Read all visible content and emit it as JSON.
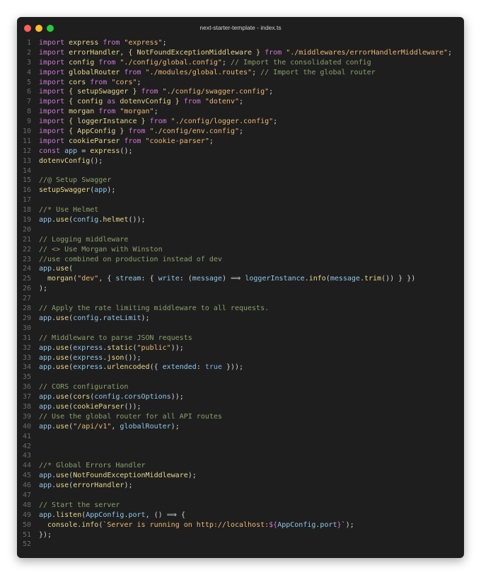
{
  "window": {
    "title": "next-starter-template - index.ts",
    "traffic_lights": [
      {
        "name": "close",
        "color": "#ff5f57"
      },
      {
        "name": "minimize",
        "color": "#febc2e"
      },
      {
        "name": "maximize",
        "color": "#28c840"
      }
    ]
  },
  "editor": {
    "lines": [
      {
        "n": "1",
        "tokens": [
          {
            "t": "import",
            "k": "keyword"
          },
          {
            "t": " express ",
            "k": "ident"
          },
          {
            "t": "from",
            "k": "keyword"
          },
          {
            "t": " \"express\"",
            "k": "string"
          },
          {
            "t": ";",
            "k": "punct"
          }
        ]
      },
      {
        "n": "2",
        "tokens": [
          {
            "t": "import",
            "k": "keyword"
          },
          {
            "t": " errorHandler, { NotFoundExceptionMiddleware } ",
            "k": "ident"
          },
          {
            "t": "from",
            "k": "keyword"
          },
          {
            "t": " \"./middlewares/errorHandlerMiddleware\"",
            "k": "string"
          },
          {
            "t": ";",
            "k": "punct"
          }
        ]
      },
      {
        "n": "3",
        "tokens": [
          {
            "t": "import",
            "k": "keyword"
          },
          {
            "t": " config ",
            "k": "ident"
          },
          {
            "t": "from",
            "k": "keyword"
          },
          {
            "t": " \"./config/global.config\"",
            "k": "string"
          },
          {
            "t": "; ",
            "k": "punct"
          },
          {
            "t": "// Import the consolidated config",
            "k": "comment"
          }
        ]
      },
      {
        "n": "4",
        "tokens": [
          {
            "t": "import",
            "k": "keyword"
          },
          {
            "t": " globalRouter ",
            "k": "ident"
          },
          {
            "t": "from",
            "k": "keyword"
          },
          {
            "t": " \"./modules/global.routes\"",
            "k": "string"
          },
          {
            "t": "; ",
            "k": "punct"
          },
          {
            "t": "// Import the global router",
            "k": "comment"
          }
        ]
      },
      {
        "n": "5",
        "tokens": [
          {
            "t": "import",
            "k": "keyword"
          },
          {
            "t": " cors ",
            "k": "ident"
          },
          {
            "t": "from",
            "k": "keyword"
          },
          {
            "t": " \"cors\"",
            "k": "string"
          },
          {
            "t": ";",
            "k": "punct"
          }
        ]
      },
      {
        "n": "6",
        "tokens": [
          {
            "t": "import",
            "k": "keyword"
          },
          {
            "t": " { setupSwagger } ",
            "k": "ident"
          },
          {
            "t": "from",
            "k": "keyword"
          },
          {
            "t": " \"./config/swagger.config\"",
            "k": "string"
          },
          {
            "t": ";",
            "k": "punct"
          }
        ]
      },
      {
        "n": "7",
        "tokens": [
          {
            "t": "import",
            "k": "keyword"
          },
          {
            "t": " { config ",
            "k": "ident"
          },
          {
            "t": "as",
            "k": "keyword"
          },
          {
            "t": " dotenvConfig } ",
            "k": "ident"
          },
          {
            "t": "from",
            "k": "keyword"
          },
          {
            "t": " \"dotenv\"",
            "k": "string"
          },
          {
            "t": ";",
            "k": "punct"
          }
        ]
      },
      {
        "n": "8",
        "tokens": [
          {
            "t": "import",
            "k": "keyword"
          },
          {
            "t": " morgan ",
            "k": "ident"
          },
          {
            "t": "from",
            "k": "keyword"
          },
          {
            "t": " \"morgan\"",
            "k": "string"
          },
          {
            "t": ";",
            "k": "punct"
          }
        ]
      },
      {
        "n": "9",
        "tokens": [
          {
            "t": "import",
            "k": "keyword"
          },
          {
            "t": " { loggerInstance } ",
            "k": "ident"
          },
          {
            "t": "from",
            "k": "keyword"
          },
          {
            "t": " \"./config/logger.config\"",
            "k": "string"
          },
          {
            "t": ";",
            "k": "punct"
          }
        ]
      },
      {
        "n": "10",
        "tokens": [
          {
            "t": "import",
            "k": "keyword"
          },
          {
            "t": " { AppConfig } ",
            "k": "ident"
          },
          {
            "t": "from",
            "k": "keyword"
          },
          {
            "t": " \"./config/env.config\"",
            "k": "string"
          },
          {
            "t": ";",
            "k": "punct"
          }
        ]
      },
      {
        "n": "11",
        "tokens": [
          {
            "t": "import",
            "k": "keyword"
          },
          {
            "t": " cookieParser ",
            "k": "ident"
          },
          {
            "t": "from",
            "k": "keyword"
          },
          {
            "t": " \"cookie-parser\"",
            "k": "string"
          },
          {
            "t": ";",
            "k": "punct"
          }
        ]
      },
      {
        "n": "12",
        "tokens": [
          {
            "t": "const",
            "k": "keyword"
          },
          {
            "t": " app ",
            "k": "var"
          },
          {
            "t": "= ",
            "k": "punct"
          },
          {
            "t": "express",
            "k": "func"
          },
          {
            "t": "();",
            "k": "punct"
          }
        ]
      },
      {
        "n": "13",
        "tokens": [
          {
            "t": "dotenvConfig",
            "k": "func"
          },
          {
            "t": "();",
            "k": "punct"
          }
        ]
      },
      {
        "n": "14",
        "tokens": []
      },
      {
        "n": "15",
        "tokens": [
          {
            "t": "//@ Setup Swagger",
            "k": "comment"
          }
        ]
      },
      {
        "n": "16",
        "tokens": [
          {
            "t": "setupSwagger",
            "k": "func"
          },
          {
            "t": "(",
            "k": "punct"
          },
          {
            "t": "app",
            "k": "var"
          },
          {
            "t": ");",
            "k": "punct"
          }
        ]
      },
      {
        "n": "17",
        "tokens": []
      },
      {
        "n": "18",
        "tokens": [
          {
            "t": "//* Use Helmet",
            "k": "comment"
          }
        ]
      },
      {
        "n": "19",
        "tokens": [
          {
            "t": "app",
            "k": "var"
          },
          {
            "t": ".",
            "k": "punct"
          },
          {
            "t": "use",
            "k": "func"
          },
          {
            "t": "(",
            "k": "punct"
          },
          {
            "t": "config",
            "k": "var"
          },
          {
            "t": ".",
            "k": "punct"
          },
          {
            "t": "helmet",
            "k": "func"
          },
          {
            "t": "());",
            "k": "punct"
          }
        ]
      },
      {
        "n": "20",
        "tokens": []
      },
      {
        "n": "21",
        "tokens": [
          {
            "t": "// Logging middleware",
            "k": "comment"
          }
        ]
      },
      {
        "n": "22",
        "tokens": [
          {
            "t": "// <> Use Morgan with Winston",
            "k": "comment"
          }
        ]
      },
      {
        "n": "23",
        "tokens": [
          {
            "t": "//use combined on production instead of dev",
            "k": "comment"
          }
        ]
      },
      {
        "n": "24",
        "tokens": [
          {
            "t": "app",
            "k": "var"
          },
          {
            "t": ".",
            "k": "punct"
          },
          {
            "t": "use",
            "k": "func"
          },
          {
            "t": "(",
            "k": "punct"
          }
        ]
      },
      {
        "n": "25",
        "tokens": [
          {
            "t": "  morgan",
            "k": "func"
          },
          {
            "t": "(",
            "k": "punct"
          },
          {
            "t": "\"dev\"",
            "k": "string"
          },
          {
            "t": ", { ",
            "k": "punct"
          },
          {
            "t": "stream",
            "k": "prop"
          },
          {
            "t": ": { ",
            "k": "punct"
          },
          {
            "t": "write",
            "k": "prop"
          },
          {
            "t": ": (",
            "k": "punct"
          },
          {
            "t": "message",
            "k": "var"
          },
          {
            "t": ") ⟹ ",
            "k": "punct"
          },
          {
            "t": "loggerInstance",
            "k": "var"
          },
          {
            "t": ".",
            "k": "punct"
          },
          {
            "t": "info",
            "k": "func"
          },
          {
            "t": "(",
            "k": "punct"
          },
          {
            "t": "message",
            "k": "var"
          },
          {
            "t": ".",
            "k": "punct"
          },
          {
            "t": "trim",
            "k": "func"
          },
          {
            "t": "()) } })",
            "k": "punct"
          }
        ]
      },
      {
        "n": "26",
        "tokens": [
          {
            "t": ");",
            "k": "punct"
          }
        ]
      },
      {
        "n": "27",
        "tokens": []
      },
      {
        "n": "28",
        "tokens": [
          {
            "t": "// Apply the rate limiting middleware to all requests.",
            "k": "comment"
          }
        ]
      },
      {
        "n": "29",
        "tokens": [
          {
            "t": "app",
            "k": "var"
          },
          {
            "t": ".",
            "k": "punct"
          },
          {
            "t": "use",
            "k": "func"
          },
          {
            "t": "(",
            "k": "punct"
          },
          {
            "t": "config",
            "k": "var"
          },
          {
            "t": ".",
            "k": "punct"
          },
          {
            "t": "rateLimit",
            "k": "prop"
          },
          {
            "t": ");",
            "k": "punct"
          }
        ]
      },
      {
        "n": "30",
        "tokens": []
      },
      {
        "n": "31",
        "tokens": [
          {
            "t": "// Middleware to parse JSON requests",
            "k": "comment"
          }
        ]
      },
      {
        "n": "32",
        "tokens": [
          {
            "t": "app",
            "k": "var"
          },
          {
            "t": ".",
            "k": "punct"
          },
          {
            "t": "use",
            "k": "func"
          },
          {
            "t": "(",
            "k": "punct"
          },
          {
            "t": "express",
            "k": "var"
          },
          {
            "t": ".",
            "k": "punct"
          },
          {
            "t": "static",
            "k": "func"
          },
          {
            "t": "(",
            "k": "punct"
          },
          {
            "t": "\"public\"",
            "k": "string"
          },
          {
            "t": "));",
            "k": "punct"
          }
        ]
      },
      {
        "n": "33",
        "tokens": [
          {
            "t": "app",
            "k": "var"
          },
          {
            "t": ".",
            "k": "punct"
          },
          {
            "t": "use",
            "k": "func"
          },
          {
            "t": "(",
            "k": "punct"
          },
          {
            "t": "express",
            "k": "var"
          },
          {
            "t": ".",
            "k": "punct"
          },
          {
            "t": "json",
            "k": "func"
          },
          {
            "t": "());",
            "k": "punct"
          }
        ]
      },
      {
        "n": "34",
        "tokens": [
          {
            "t": "app",
            "k": "var"
          },
          {
            "t": ".",
            "k": "punct"
          },
          {
            "t": "use",
            "k": "func"
          },
          {
            "t": "(",
            "k": "punct"
          },
          {
            "t": "express",
            "k": "var"
          },
          {
            "t": ".",
            "k": "punct"
          },
          {
            "t": "urlencoded",
            "k": "func"
          },
          {
            "t": "({ ",
            "k": "punct"
          },
          {
            "t": "extended",
            "k": "prop"
          },
          {
            "t": ": ",
            "k": "punct"
          },
          {
            "t": "true",
            "k": "bool"
          },
          {
            "t": " }));",
            "k": "punct"
          }
        ]
      },
      {
        "n": "35",
        "tokens": []
      },
      {
        "n": "36",
        "tokens": [
          {
            "t": "// CORS configuration",
            "k": "comment"
          }
        ]
      },
      {
        "n": "37",
        "tokens": [
          {
            "t": "app",
            "k": "var"
          },
          {
            "t": ".",
            "k": "punct"
          },
          {
            "t": "use",
            "k": "func"
          },
          {
            "t": "(",
            "k": "punct"
          },
          {
            "t": "cors",
            "k": "func"
          },
          {
            "t": "(",
            "k": "punct"
          },
          {
            "t": "config",
            "k": "var"
          },
          {
            "t": ".",
            "k": "punct"
          },
          {
            "t": "corsOptions",
            "k": "prop"
          },
          {
            "t": "));",
            "k": "punct"
          }
        ]
      },
      {
        "n": "38",
        "tokens": [
          {
            "t": "app",
            "k": "var"
          },
          {
            "t": ".",
            "k": "punct"
          },
          {
            "t": "use",
            "k": "func"
          },
          {
            "t": "(",
            "k": "punct"
          },
          {
            "t": "cookieParser",
            "k": "func"
          },
          {
            "t": "());",
            "k": "punct"
          }
        ]
      },
      {
        "n": "39",
        "tokens": [
          {
            "t": "// Use the global router for all API routes",
            "k": "comment"
          }
        ]
      },
      {
        "n": "40",
        "tokens": [
          {
            "t": "app",
            "k": "var"
          },
          {
            "t": ".",
            "k": "punct"
          },
          {
            "t": "use",
            "k": "func"
          },
          {
            "t": "(",
            "k": "punct"
          },
          {
            "t": "\"/api/v1\"",
            "k": "string"
          },
          {
            "t": ", ",
            "k": "punct"
          },
          {
            "t": "globalRouter",
            "k": "var"
          },
          {
            "t": ");",
            "k": "punct"
          }
        ]
      },
      {
        "n": "41",
        "tokens": []
      },
      {
        "n": "42",
        "tokens": []
      },
      {
        "n": "43",
        "tokens": []
      },
      {
        "n": "44",
        "tokens": [
          {
            "t": "//* Global Errors Handler",
            "k": "comment"
          }
        ]
      },
      {
        "n": "45",
        "tokens": [
          {
            "t": "app",
            "k": "var"
          },
          {
            "t": ".",
            "k": "punct"
          },
          {
            "t": "use",
            "k": "func"
          },
          {
            "t": "(",
            "k": "punct"
          },
          {
            "t": "NotFoundExceptionMiddleware",
            "k": "func"
          },
          {
            "t": ");",
            "k": "punct"
          }
        ]
      },
      {
        "n": "46",
        "tokens": [
          {
            "t": "app",
            "k": "var"
          },
          {
            "t": ".",
            "k": "punct"
          },
          {
            "t": "use",
            "k": "func"
          },
          {
            "t": "(",
            "k": "punct"
          },
          {
            "t": "errorHandler",
            "k": "func"
          },
          {
            "t": ");",
            "k": "punct"
          }
        ]
      },
      {
        "n": "47",
        "tokens": []
      },
      {
        "n": "48",
        "tokens": [
          {
            "t": "// Start the server",
            "k": "comment"
          }
        ]
      },
      {
        "n": "49",
        "tokens": [
          {
            "t": "app",
            "k": "var"
          },
          {
            "t": ".",
            "k": "punct"
          },
          {
            "t": "listen",
            "k": "func"
          },
          {
            "t": "(",
            "k": "punct"
          },
          {
            "t": "AppConfig",
            "k": "var"
          },
          {
            "t": ".",
            "k": "punct"
          },
          {
            "t": "port",
            "k": "prop"
          },
          {
            "t": ", () ⟹ {",
            "k": "punct"
          }
        ]
      },
      {
        "n": "50",
        "tokens": [
          {
            "t": "  console",
            "k": "ident"
          },
          {
            "t": ".",
            "k": "punct"
          },
          {
            "t": "info",
            "k": "func"
          },
          {
            "t": "(",
            "k": "punct"
          },
          {
            "t": "`Server is running on http://localhost:",
            "k": "string"
          },
          {
            "t": "${",
            "k": "keyword"
          },
          {
            "t": "AppConfig",
            "k": "var"
          },
          {
            "t": ".",
            "k": "punct"
          },
          {
            "t": "port",
            "k": "prop"
          },
          {
            "t": "}",
            "k": "keyword"
          },
          {
            "t": "`",
            "k": "string"
          },
          {
            "t": ");",
            "k": "punct"
          }
        ]
      },
      {
        "n": "51",
        "tokens": [
          {
            "t": "});",
            "k": "punct"
          }
        ]
      },
      {
        "n": "52",
        "tokens": []
      }
    ]
  }
}
